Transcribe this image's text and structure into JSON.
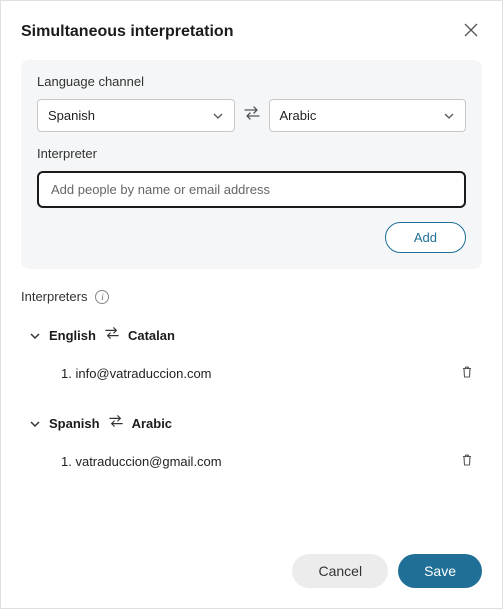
{
  "title": "Simultaneous interpretation",
  "panel": {
    "channel_label": "Language channel",
    "source_lang": "Spanish",
    "target_lang": "Arabic",
    "interpreter_label": "Interpreter",
    "interpreter_placeholder": "Add people by name or email address",
    "add_label": "Add"
  },
  "list": {
    "title": "Interpreters",
    "groups": [
      {
        "source": "English",
        "target": "Catalan",
        "items": [
          {
            "index": "1.",
            "value": "info@vatraduccion.com"
          }
        ]
      },
      {
        "source": "Spanish",
        "target": "Arabic",
        "items": [
          {
            "index": "1.",
            "value": "vatraduccion@gmail.com"
          }
        ]
      }
    ]
  },
  "footer": {
    "cancel": "Cancel",
    "save": "Save"
  }
}
